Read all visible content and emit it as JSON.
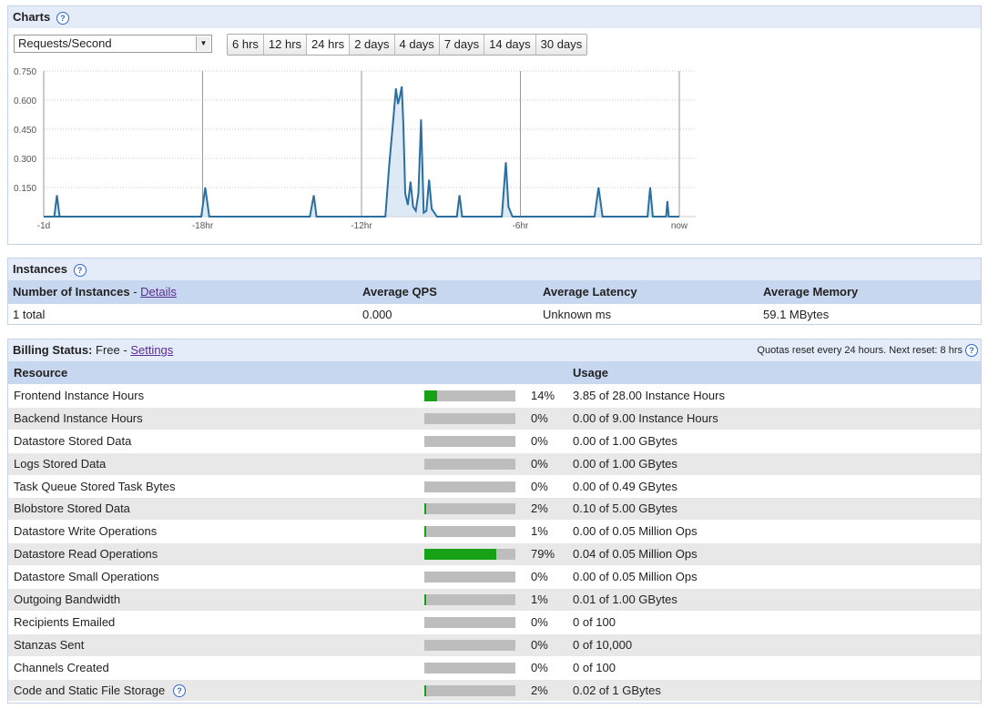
{
  "charts": {
    "title": "Charts",
    "metric_select": "Requests/Second",
    "ranges": [
      "6 hrs",
      "12 hrs",
      "24 hrs",
      "2 days",
      "4 days",
      "7 days",
      "14 days",
      "30 days"
    ],
    "active_range": "24 hrs"
  },
  "chart_data": {
    "type": "line",
    "title": "",
    "ylim": [
      0,
      0.75
    ],
    "y_ticks": [
      "0.750",
      "0.600",
      "0.450",
      "0.300",
      "0.150"
    ],
    "x_ticks": [
      "-1d",
      "-18hr",
      "-12hr",
      "-6hr",
      "now"
    ],
    "series": [
      {
        "color": "#2a6fa0",
        "x_hours": [
          -24,
          -23.6,
          -23.5,
          -23.4,
          -24,
          -18.05,
          -17.9,
          -17.75,
          -13.95,
          -13.8,
          -13.7,
          -11.1,
          -10.95,
          -10.8,
          -10.7,
          -10.62,
          -10.55,
          -10.48,
          -10.42,
          -10.35,
          -10.25,
          -10.15,
          -10.05,
          -9.95,
          -9.85,
          -9.75,
          -9.65,
          -9.55,
          -9.45,
          -9.35,
          -9.25,
          -9.15,
          -9.05,
          -8.95,
          -8.85,
          -8.4,
          -8.3,
          -8.2,
          -6.7,
          -6.55,
          -6.45,
          -6.3,
          -6.2,
          -3.2,
          -3.05,
          -2.9,
          -1.2,
          -1.1,
          -1.0,
          -0.5,
          -0.45,
          -0.4,
          0
        ],
        "values": [
          0,
          0,
          0.11,
          0,
          0,
          0,
          0.15,
          0,
          0,
          0.11,
          0,
          0,
          0.27,
          0.5,
          0.66,
          0.58,
          0.62,
          0.67,
          0.47,
          0.12,
          0.06,
          0.18,
          0.05,
          0.03,
          0.12,
          0.5,
          0.02,
          0.03,
          0.19,
          0.04,
          0.02,
          0.0,
          0.0,
          0.0,
          0.0,
          0.0,
          0.11,
          0.0,
          0.0,
          0.28,
          0.05,
          0.0,
          0.0,
          0.0,
          0.15,
          0.0,
          0.0,
          0.15,
          0.0,
          0.0,
          0.08,
          0.0,
          0.0
        ]
      }
    ]
  },
  "instances": {
    "title": "Instances",
    "col_number": "Number of Instances",
    "details_link": "Details",
    "col_qps": "Average QPS",
    "col_latency": "Average Latency",
    "col_memory": "Average Memory",
    "row": {
      "number": "1 total",
      "qps": "0.000",
      "latency": "Unknown ms",
      "memory": "59.1 MBytes"
    }
  },
  "billing": {
    "title": "Billing Status:",
    "status": "Free",
    "separator": " - ",
    "settings_link": "Settings",
    "quota_note": "Quotas reset every 24 hours. Next reset: 8 hrs",
    "col_resource": "Resource",
    "col_usage": "Usage",
    "rows": [
      {
        "resource": "Frontend Instance Hours",
        "pct": "14%",
        "usage": "3.85 of 28.00 Instance Hours",
        "fill": 0.14
      },
      {
        "resource": "Backend Instance Hours",
        "pct": "0%",
        "usage": "0.00 of 9.00 Instance Hours",
        "fill": 0
      },
      {
        "resource": "Datastore Stored Data",
        "pct": "0%",
        "usage": "0.00 of 1.00 GBytes",
        "fill": 0
      },
      {
        "resource": "Logs Stored Data",
        "pct": "0%",
        "usage": "0.00 of 1.00 GBytes",
        "fill": 0
      },
      {
        "resource": "Task Queue Stored Task Bytes",
        "pct": "0%",
        "usage": "0.00 of 0.49 GBytes",
        "fill": 0
      },
      {
        "resource": "Blobstore Stored Data",
        "pct": "2%",
        "usage": "0.10 of 5.00 GBytes",
        "fill": 0.02
      },
      {
        "resource": "Datastore Write Operations",
        "pct": "1%",
        "usage": "0.00 of 0.05 Million Ops",
        "fill": 0.01
      },
      {
        "resource": "Datastore Read Operations",
        "pct": "79%",
        "usage": "0.04 of 0.05 Million Ops",
        "fill": 0.79
      },
      {
        "resource": "Datastore Small Operations",
        "pct": "0%",
        "usage": "0.00 of 0.05 Million Ops",
        "fill": 0
      },
      {
        "resource": "Outgoing Bandwidth",
        "pct": "1%",
        "usage": "0.01 of 1.00 GBytes",
        "fill": 0.01
      },
      {
        "resource": "Recipients Emailed",
        "pct": "0%",
        "usage": "0 of 100",
        "fill": 0
      },
      {
        "resource": "Stanzas Sent",
        "pct": "0%",
        "usage": "0 of 10,000",
        "fill": 0
      },
      {
        "resource": "Channels Created",
        "pct": "0%",
        "usage": "0 of 100",
        "fill": 0
      },
      {
        "resource": "Code and Static File Storage",
        "pct": "2%",
        "usage": "0.02 of 1 GBytes",
        "fill": 0.02,
        "help": true
      }
    ]
  },
  "help_glyph": "?",
  "select_arrow_glyph": "▼"
}
